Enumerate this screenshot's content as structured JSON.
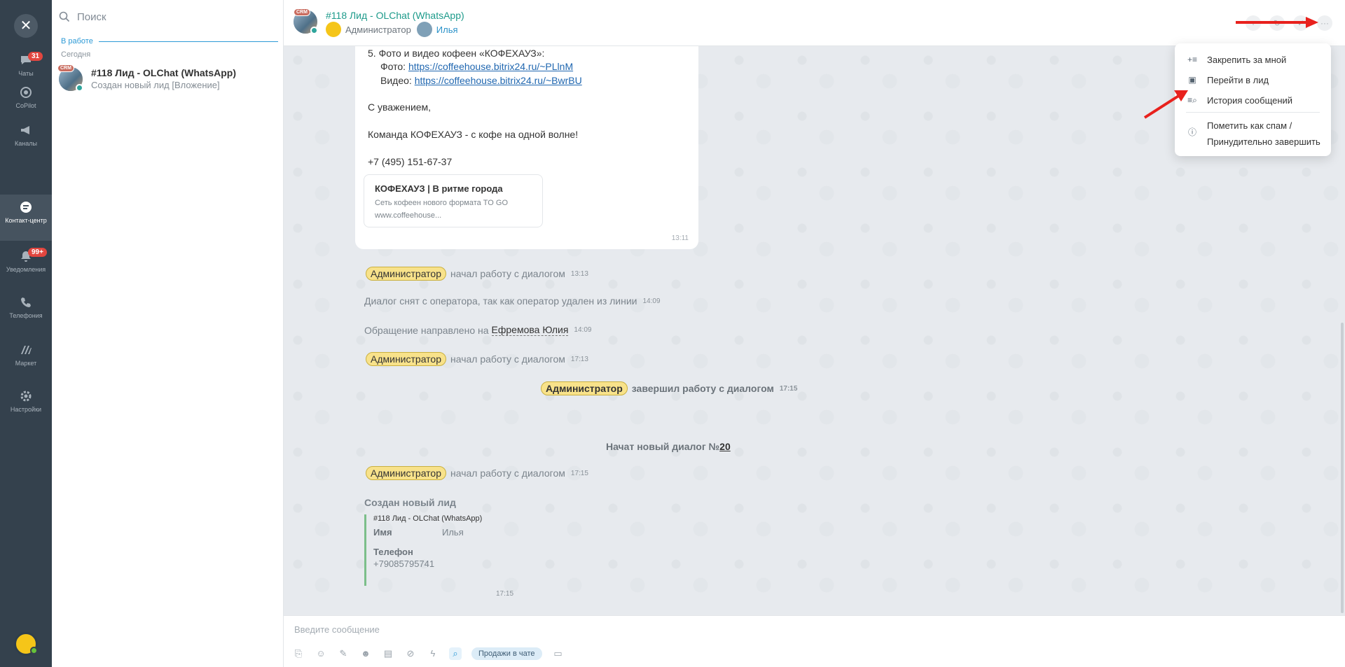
{
  "rail": {
    "close": "✕",
    "items": [
      {
        "label": "Чаты",
        "badge": "31"
      },
      {
        "label": "CoPilot",
        "badge": ""
      },
      {
        "label": "Каналы",
        "badge": ""
      },
      {
        "label": "Контакт-центр",
        "badge": ""
      },
      {
        "label": "Уведомления",
        "badge": "99+"
      },
      {
        "label": "Телефония",
        "badge": ""
      },
      {
        "label": "Маркет",
        "badge": ""
      },
      {
        "label": "Настройки",
        "badge": ""
      }
    ]
  },
  "sidebar": {
    "search_placeholder": "Поиск",
    "section": "В работе",
    "today": "Сегодня",
    "chat": {
      "title": "#118 Лид - OLChat (WhatsApp)",
      "subtitle": "Создан новый лид [Вложение]",
      "crm": "CRM"
    }
  },
  "header": {
    "crm": "CRM",
    "title": "#118 Лид - OLChat (WhatsApp)",
    "role": "Администратор",
    "user": "Илья",
    "more": "···"
  },
  "message": {
    "line1": "5. Фото и видео кофеен «КОФЕХАУЗ»:",
    "photo_label": "Фото:",
    "photo_url": "https://coffeehouse.bitrix24.ru/~PLlnM",
    "video_label": "Видео:",
    "video_url": "https://coffeehouse.bitrix24.ru/~BwrBU",
    "regards": "С уважением,",
    "team": "Команда КОФЕХАУЗ - с кофе на одной волне!",
    "phone": "+7 (495) 151-67-37",
    "card_title": "КОФЕХАУЗ | В ритме города",
    "card_desc": "Сеть кофеен нового формата TO GO",
    "card_url": "www.coffeehouse...",
    "time": "13:11"
  },
  "system": {
    "admin": "Администратор",
    "started": "начал работу с диалогом",
    "t1": "13:13",
    "removed": "Диалог снят с оператора, так как оператор удален из линии",
    "t2": "14:09",
    "forwarded": "Обращение направлено на",
    "forward_to": "Ефремова Юлия",
    "t3": "14:09",
    "t4": "17:13",
    "finished": "завершил работу с диалогом",
    "t5": "17:15",
    "new_dialog": "Начат новый диалог №",
    "dialog_no": "20",
    "t6": "17:15"
  },
  "lead": {
    "title": "Создан новый лид",
    "ref": "#118 Лид - OLChat (WhatsApp)",
    "name_label": "Имя",
    "name_value": "Илья",
    "phone_label": "Телефон",
    "phone_value": "+79085795741",
    "time": "17:15"
  },
  "composer": {
    "placeholder": "Введите сообщение",
    "sales_pill": "Продажи в чате"
  },
  "menu": {
    "pin": "Закрепить за мной",
    "go_lead": "Перейти в лид",
    "history": "История сообщений",
    "spam_1": "Пометить как спам /",
    "spam_2": "Принудительно завершить"
  },
  "colors": {
    "accent": "#2d9ad6",
    "title_green": "#1e9b8b",
    "arrow_red": "#e8211d"
  }
}
